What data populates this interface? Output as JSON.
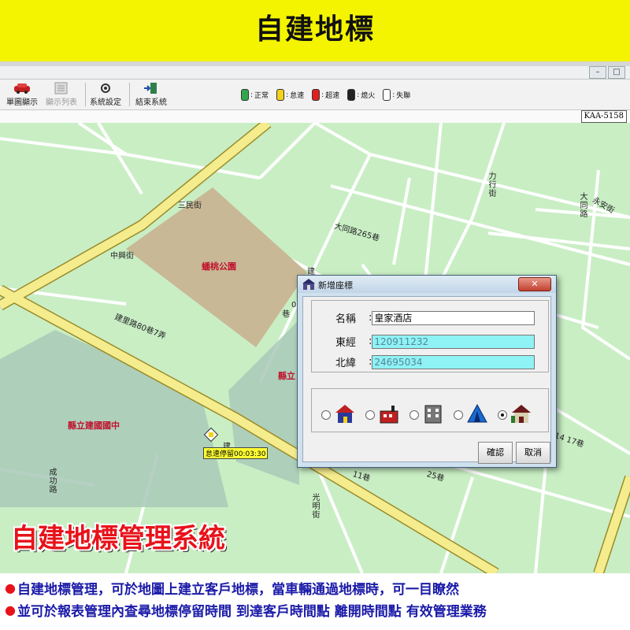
{
  "banner": {
    "title": "自建地標"
  },
  "window": {
    "min": "–",
    "max": "□"
  },
  "toolbar": {
    "buttons": [
      {
        "label": "單圖顯示",
        "icon": "car-icon"
      },
      {
        "label": "顯示列表",
        "icon": "list-icon",
        "disabled": true
      },
      {
        "label": "系統設定",
        "icon": "settings-icon"
      },
      {
        "label": "結束系統",
        "icon": "exit-icon"
      }
    ],
    "legend": [
      {
        "label": "正常",
        "color": "#2fa84a"
      },
      {
        "label": "怠速",
        "color": "#f2d21a"
      },
      {
        "label": "超速",
        "color": "#e02020"
      },
      {
        "label": "熄火",
        "color": "#222222"
      },
      {
        "label": "失聯",
        "color": "#ffffff"
      }
    ]
  },
  "status": {
    "plate": "KAA-5158"
  },
  "map": {
    "streets": {
      "sanmin": "三民街",
      "zhongxing": "中興街",
      "datong265": "大同路265巷",
      "liyxing": "力行街",
      "datong": "大同路",
      "yongan": "永安街",
      "jianli80_7": "建里路80巷7弄",
      "chenggong": "成功路",
      "guangming": "光明街",
      "lane14_17": "14 17巷",
      "lane11": "11巷",
      "lane25": "25巷",
      "jian_top": "建",
      "frag1": "0",
      "frag2": "巷",
      "jian2": "建"
    },
    "areas": {
      "park": "蟠桃公園",
      "school": "縣立建國國中",
      "school2": "縣立"
    },
    "vehicle_tag": "怠速停留00:03:30"
  },
  "dialog": {
    "title": "新增座標",
    "close": "✕",
    "name_label": "名稱",
    "name_value": "皇家酒店",
    "lon_label": "東經",
    "lon_value": "120911232",
    "lat_label": "北緯",
    "lat_value": "24695034",
    "icon_options": [
      "house-icon",
      "factory-icon",
      "office-icon",
      "tent-icon",
      "villa-icon"
    ],
    "selected_icon": 4,
    "ok": "確認",
    "cancel": "取消"
  },
  "footer": {
    "system_title": "自建地標管理系統",
    "lines": [
      "自建地標管理，可於地圖上建立客戶地標，當車輛通過地標時，可一目瞭然",
      "並可於報表管理內查尋地標停留時間 到達客戶時間點 離開時間點 有效管理業務"
    ]
  }
}
